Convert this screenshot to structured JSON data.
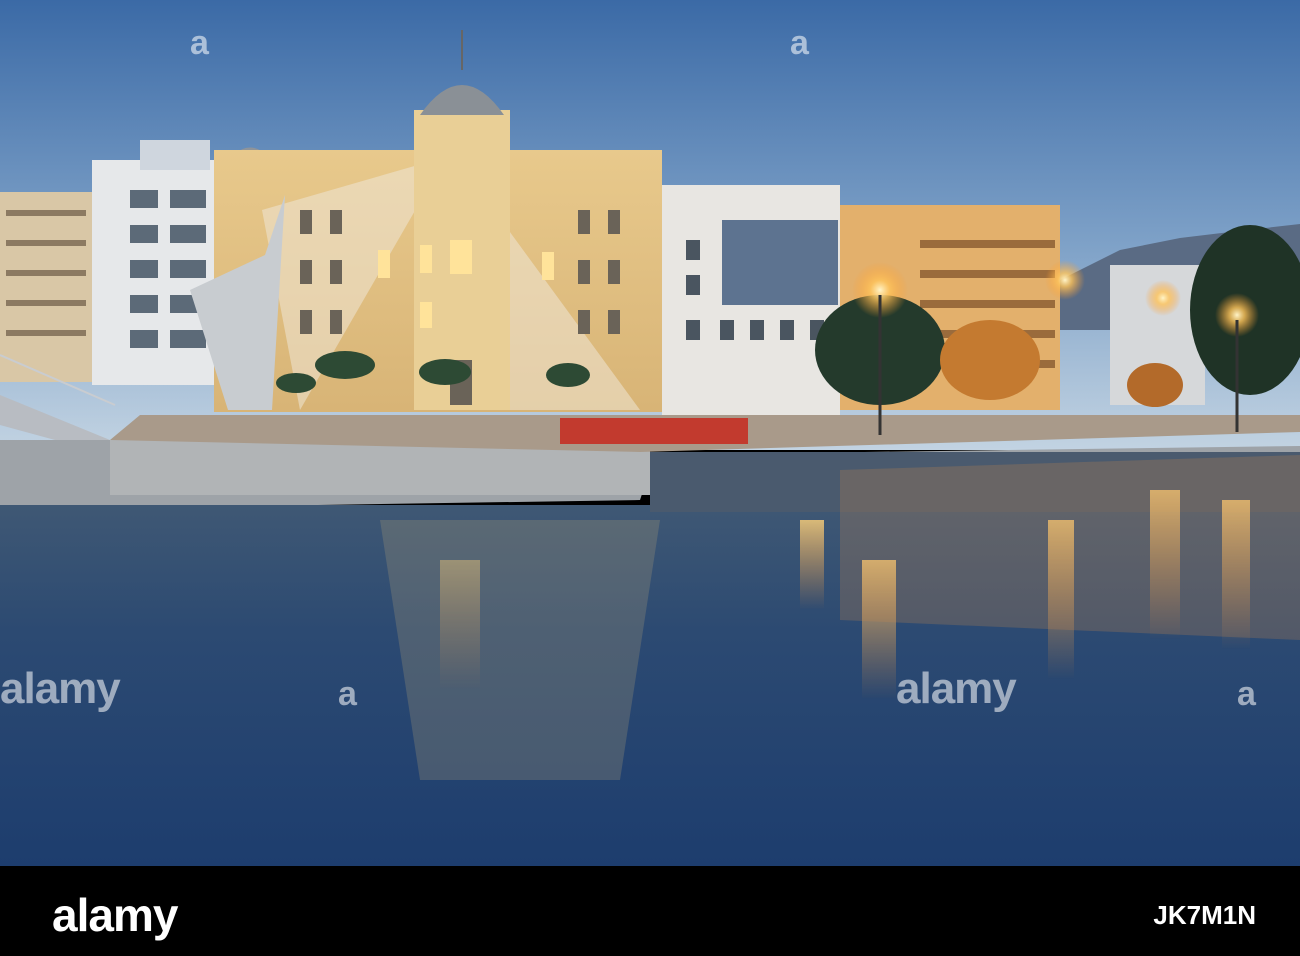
{
  "watermark": {
    "text": "alamy",
    "mark": "a"
  },
  "footer": {
    "logo": "alamy",
    "image_id": "JK7M1N",
    "background": "#000000"
  },
  "scene": {
    "sky_top": "#3f6ea8",
    "sky_bottom": "#b9cde0",
    "water": "#26456f",
    "light_glow": "#ffb84a"
  }
}
